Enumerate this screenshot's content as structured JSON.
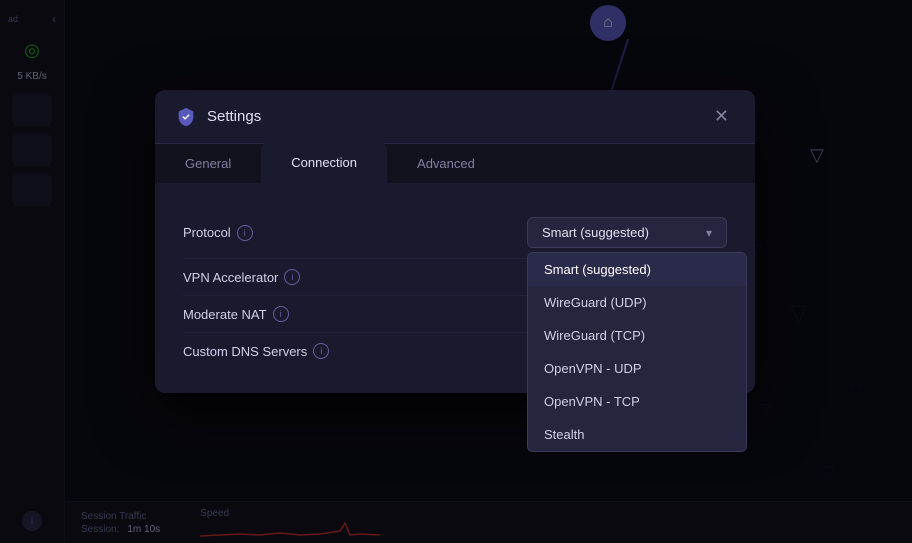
{
  "app": {
    "title": "Settings"
  },
  "sidebar": {
    "speed": "5 KB/s",
    "info_label": "i"
  },
  "tabs": [
    {
      "id": "general",
      "label": "General",
      "active": false
    },
    {
      "id": "connection",
      "label": "Connection",
      "active": true
    },
    {
      "id": "advanced",
      "label": "Advanced",
      "active": false
    }
  ],
  "settings": {
    "protocol": {
      "label": "Protocol",
      "value": "Smart (suggested)",
      "options": [
        {
          "id": "smart",
          "label": "Smart (suggested)",
          "selected": true
        },
        {
          "id": "wireguard-udp",
          "label": "WireGuard (UDP)",
          "selected": false
        },
        {
          "id": "wireguard-tcp",
          "label": "WireGuard (TCP)",
          "selected": false
        },
        {
          "id": "openvpn-udp",
          "label": "OpenVPN - UDP",
          "selected": false
        },
        {
          "id": "openvpn-tcp",
          "label": "OpenVPN - TCP",
          "selected": false
        },
        {
          "id": "stealth",
          "label": "Stealth",
          "selected": false
        }
      ]
    },
    "vpn_accelerator": {
      "label": "VPN Accelerator"
    },
    "moderate_nat": {
      "label": "Moderate NAT"
    },
    "custom_dns": {
      "label": "Custom DNS Servers"
    }
  },
  "status_bar": {
    "session_label": "Session Traffic",
    "speed_label": "Speed",
    "session_field": "Session:",
    "session_value": "1m 10s"
  },
  "icons": {
    "close": "✕",
    "info": "i",
    "home": "⌂",
    "chevron_down": "▾"
  }
}
